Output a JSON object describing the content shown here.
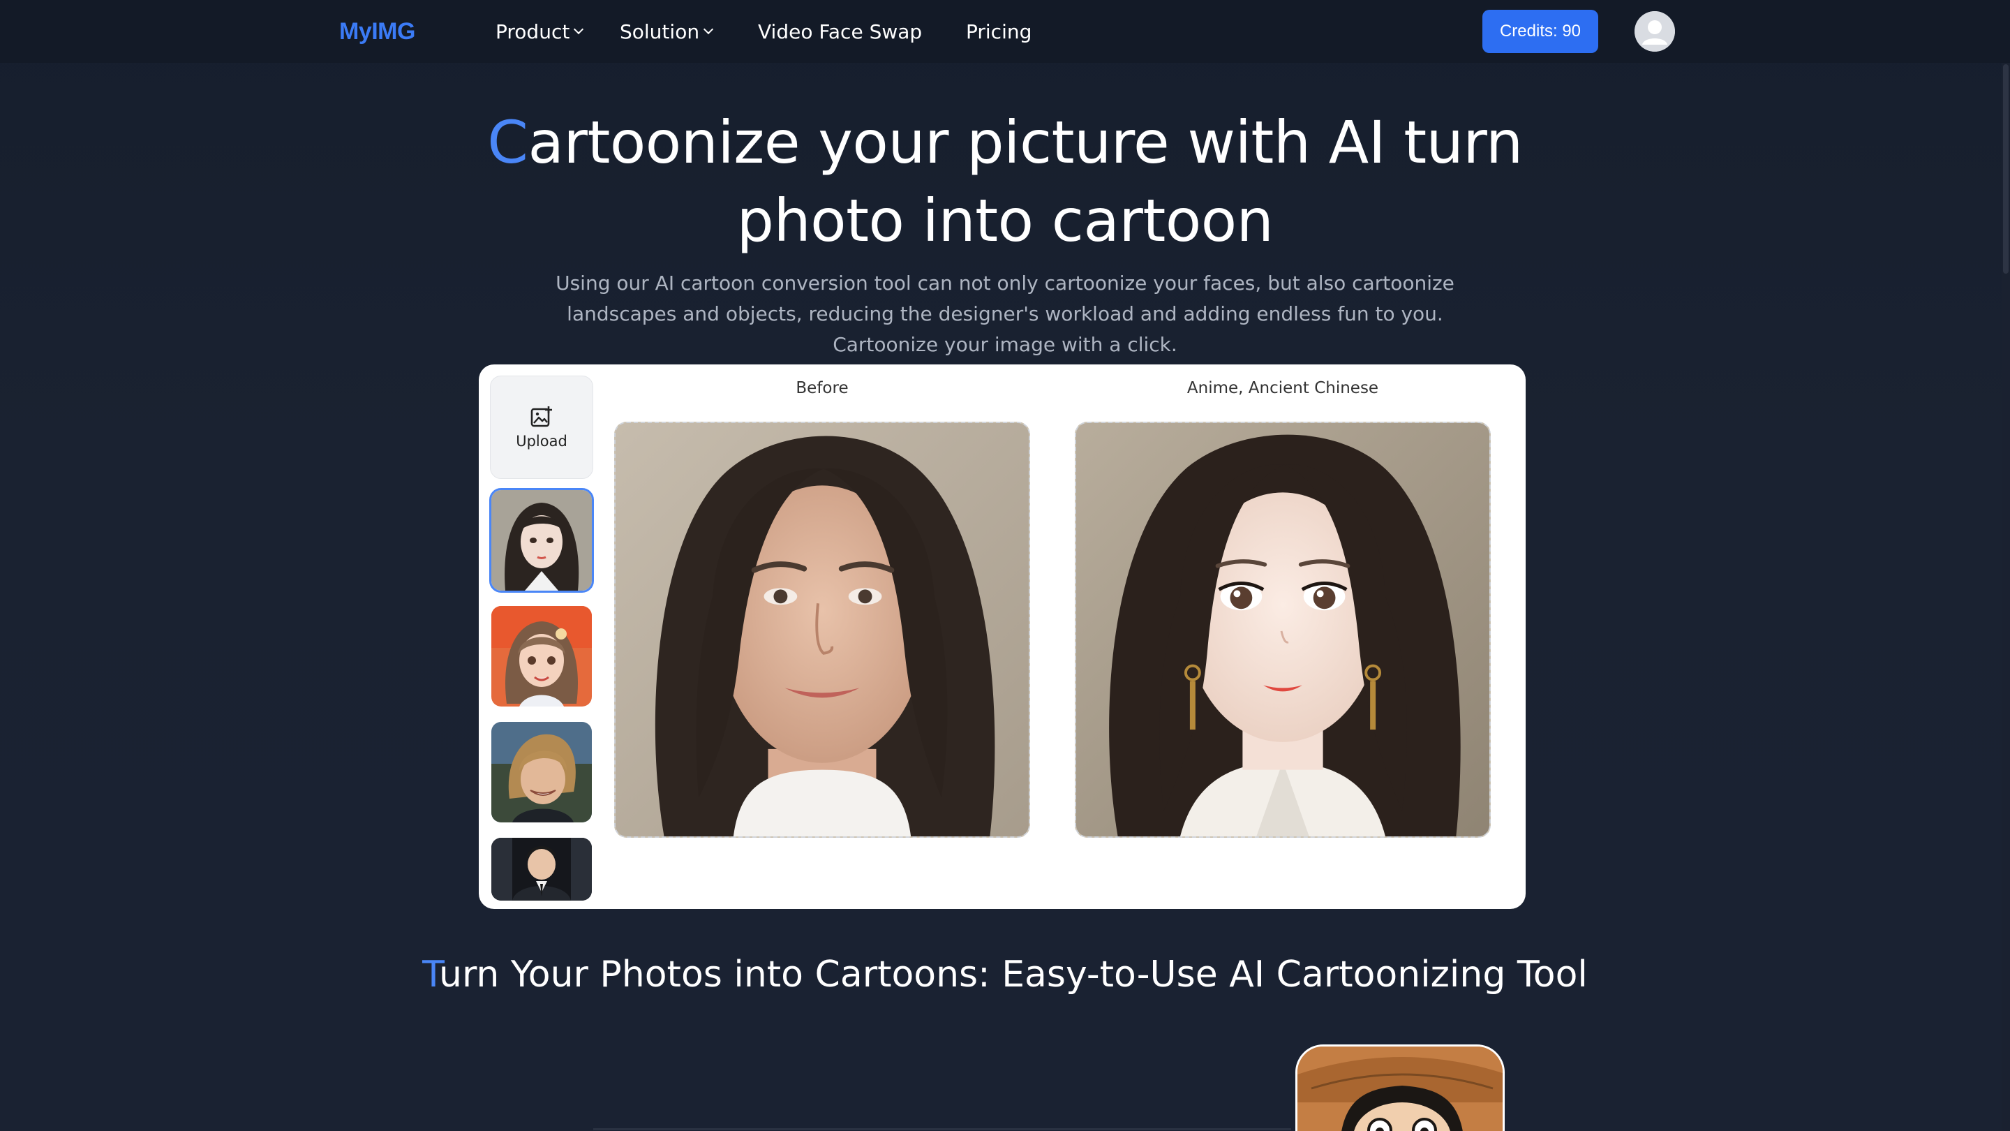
{
  "navbar": {
    "logo": "MyIMG",
    "items": [
      {
        "label": "Product",
        "has_dropdown": true
      },
      {
        "label": "Solution",
        "has_dropdown": true
      },
      {
        "label": "Video Face Swap",
        "has_dropdown": false
      },
      {
        "label": "Pricing",
        "has_dropdown": false
      }
    ],
    "credits_label": "Credits: 90",
    "avatar_icon": "user-avatar-icon"
  },
  "hero": {
    "title_accent": "C",
    "title_line1_rest": "artoonize your picture with AI turn",
    "title_line2": "photo into cartoon",
    "subtitle": "Using our AI cartoon conversion tool can not only cartoonize your faces, but also cartoonize landscapes and objects, reducing the designer's workload and adding endless fun to you. Cartoonize your image with a click."
  },
  "tool": {
    "upload_label": "Upload",
    "upload_icon": "image-upload-icon",
    "thumbnails": [
      {
        "name": "anime-girl-thumbnail",
        "selected": true
      },
      {
        "name": "anime-flower-girl-thumbnail",
        "selected": false
      },
      {
        "name": "smiling-man-thumbnail",
        "selected": false
      },
      {
        "name": "suited-man-thumbnail",
        "selected": false
      }
    ],
    "before_label": "Before",
    "after_label": "Anime, Ancient Chinese"
  },
  "section2": {
    "title_accent": "T",
    "title_rest": "urn Your Photos into Cartoons: Easy-to-Use AI Cartoonizing Tool"
  },
  "colors": {
    "background": "#18202f",
    "navbar": "#131a27",
    "accent": "#4a86f7",
    "credits_button": "#2d6ef2",
    "subtitle_text": "#aeb5c2",
    "card": "#ffffff"
  }
}
